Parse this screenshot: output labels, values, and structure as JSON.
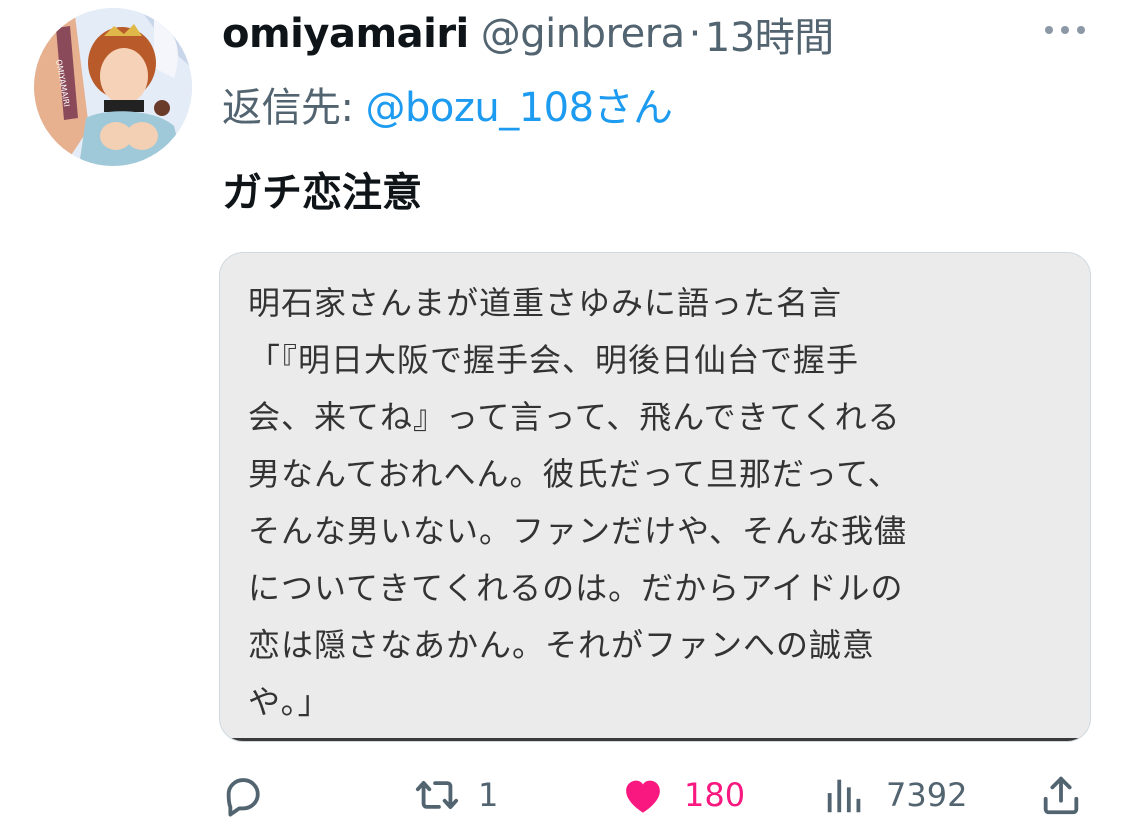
{
  "tweet": {
    "author": {
      "display_name": "omiyamairi",
      "handle": "@ginbrera",
      "separator": "·",
      "timestamp": "13時間",
      "avatar_caption": "OMIYAMAIRI"
    },
    "reply_to": {
      "prefix": "返信先:",
      "handle": "@bozu_108さん"
    },
    "text": "ガチ恋注意",
    "media": {
      "lines": [
        "明石家さんまが道重さゆみに語った名言",
        "「『明日大阪で握手会、明後日仙台で握手",
        "会、来てね』って言って、飛んできてくれる",
        "男なんておれへん。彼氏だって旦那だって、",
        "そんな男いない。ファンだけや、そんな我儘",
        "についてきてくれるのは。だからアイドルの",
        "恋は隠さなあかん。それがファンへの誠意",
        "や。」"
      ]
    },
    "actions": {
      "reply": {
        "icon": "reply-icon"
      },
      "retweet": {
        "icon": "retweet-icon",
        "count": "1"
      },
      "like": {
        "icon": "heart-icon",
        "count": "180",
        "liked": true,
        "color": "#f91880"
      },
      "views": {
        "icon": "views-icon",
        "count": "7392"
      },
      "share": {
        "icon": "share-icon"
      }
    }
  },
  "colors": {
    "text_primary": "#0f1419",
    "text_secondary": "#536471",
    "link": "#1d9bf0",
    "like": "#f91880"
  }
}
